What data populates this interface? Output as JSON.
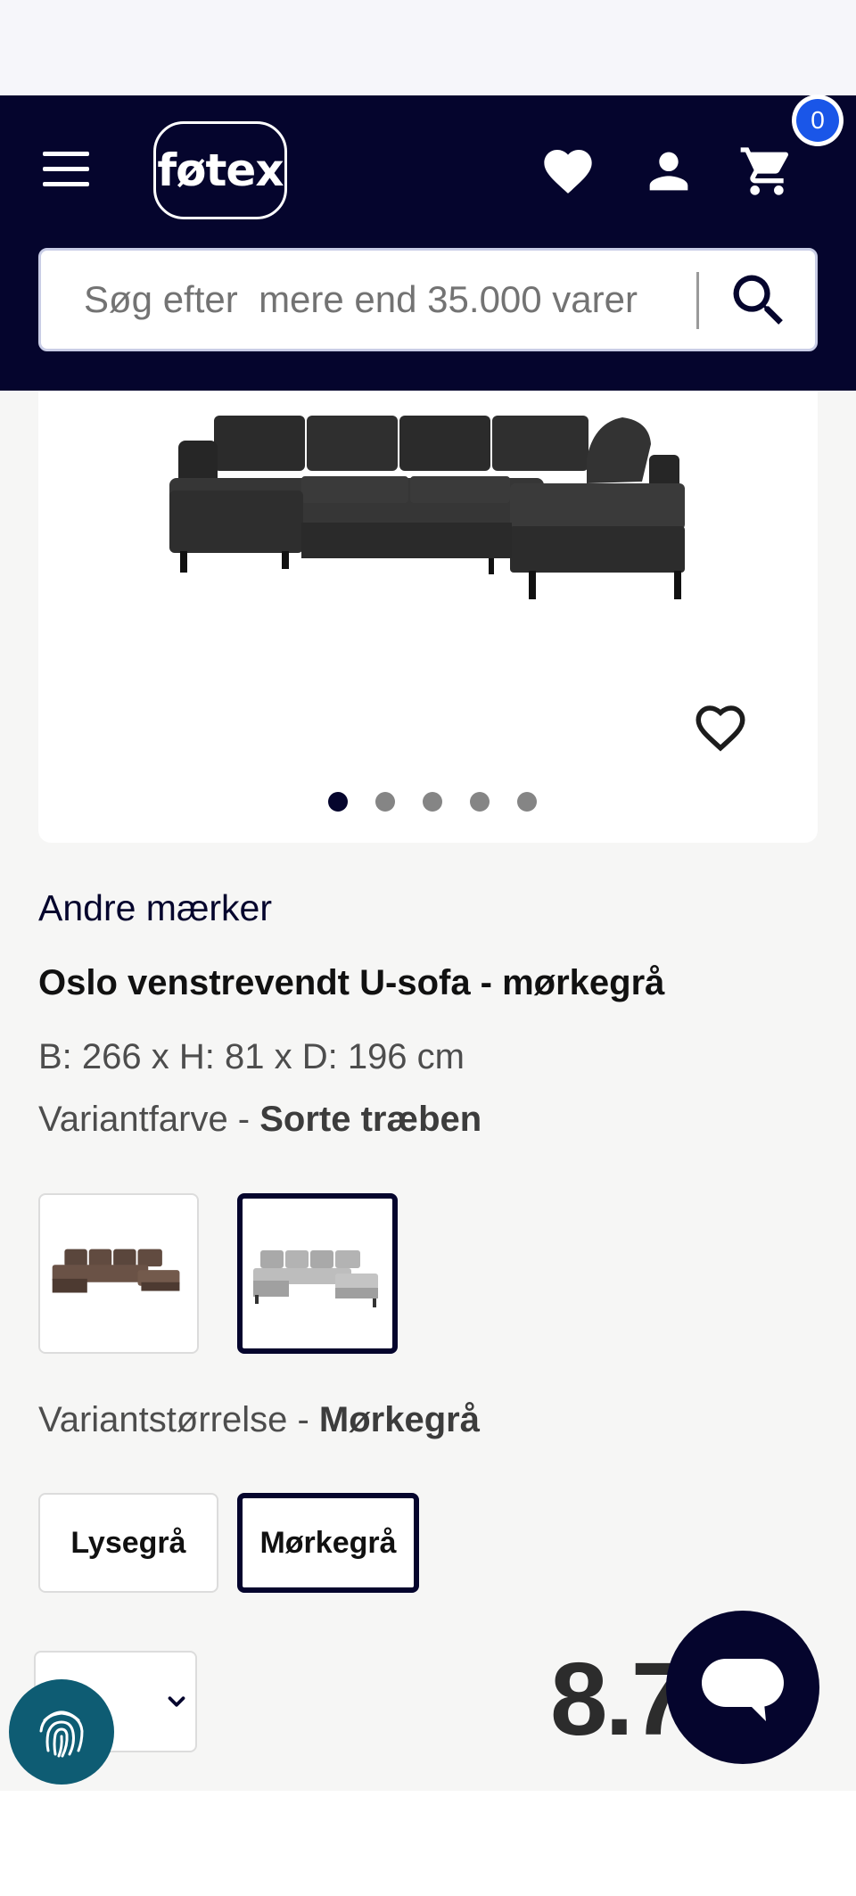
{
  "header": {
    "logo_text": "føtex",
    "cart_count": "0",
    "brand_color": "#05052d",
    "badge_color": "#1a56e8",
    "icons": [
      "menu-icon",
      "heart-icon",
      "user-icon",
      "cart-icon",
      "search-icon"
    ]
  },
  "search": {
    "placeholder": "Søg efter  mere end 35.000 varer"
  },
  "gallery": {
    "dots_count": 5,
    "active_dot": 1
  },
  "product": {
    "brand": "Andre mærker",
    "title": "Oslo venstrevendt U-sofa - mørkegrå",
    "dimensions": "B: 266 x H: 81 x D: 196 cm",
    "variant_color_label": "Variantfarve - ",
    "variant_color_value": "Sorte træben",
    "variant_size_label": "Variantstørrelse - ",
    "variant_size_value": "Mørkegrå",
    "sizes": [
      "Lysegrå",
      "Mørkegrå"
    ],
    "selected_size": "Mørkegrå",
    "price": "8.7"
  }
}
